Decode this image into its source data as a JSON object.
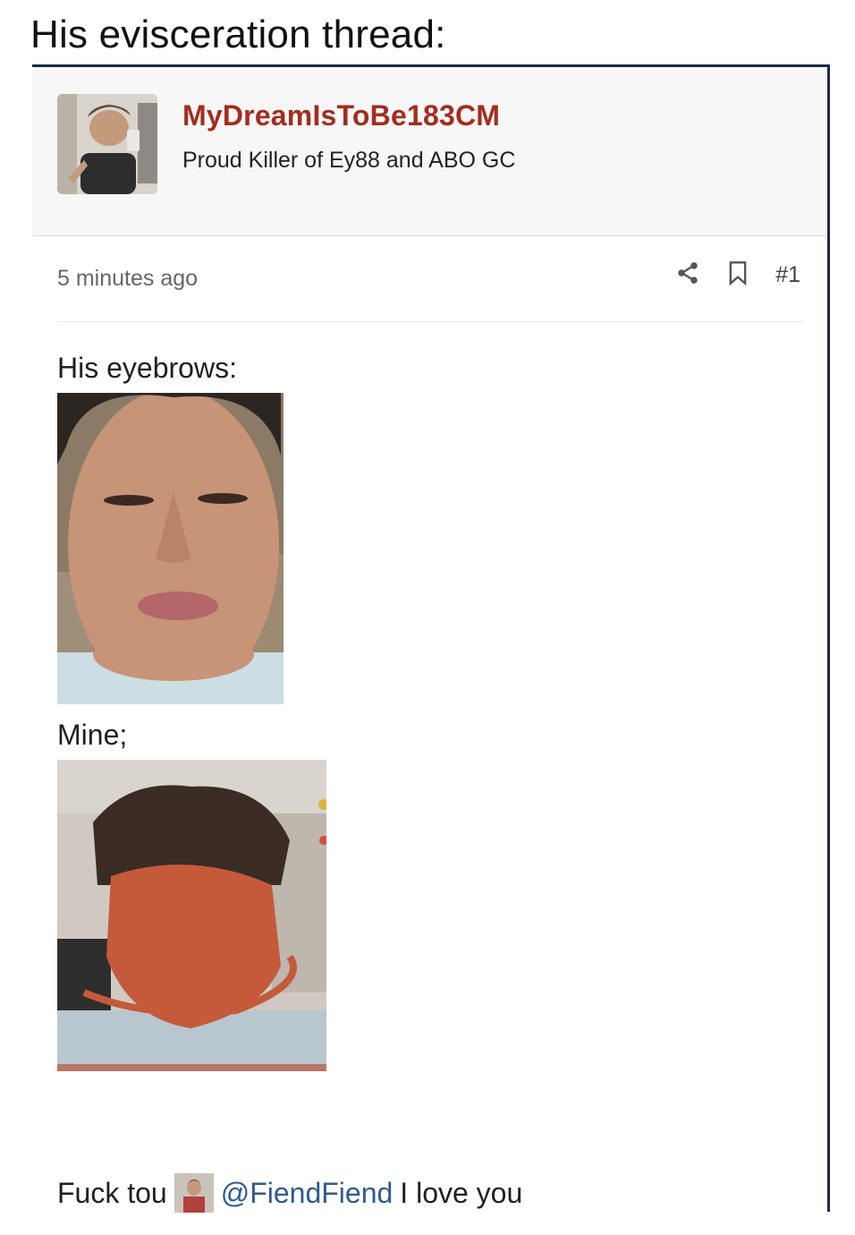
{
  "caption": "His evisceration thread:",
  "post": {
    "username": "MyDreamIsToBe183CM",
    "user_title": "Proud Killer of Ey88 and ABO GC",
    "time_ago": "5 minutes ago",
    "post_number": "#1",
    "line1": "His eyebrows:",
    "line2": "Mine;",
    "final_prefix": "Fuck tou",
    "mention": "@FiendFiend",
    "final_suffix": "I love you"
  },
  "icons": {
    "share": "share-icon",
    "bookmark": "bookmark-icon"
  },
  "colors": {
    "username": "#a32d20",
    "mention": "#2f5b8f",
    "border": "#1c2a4a"
  }
}
